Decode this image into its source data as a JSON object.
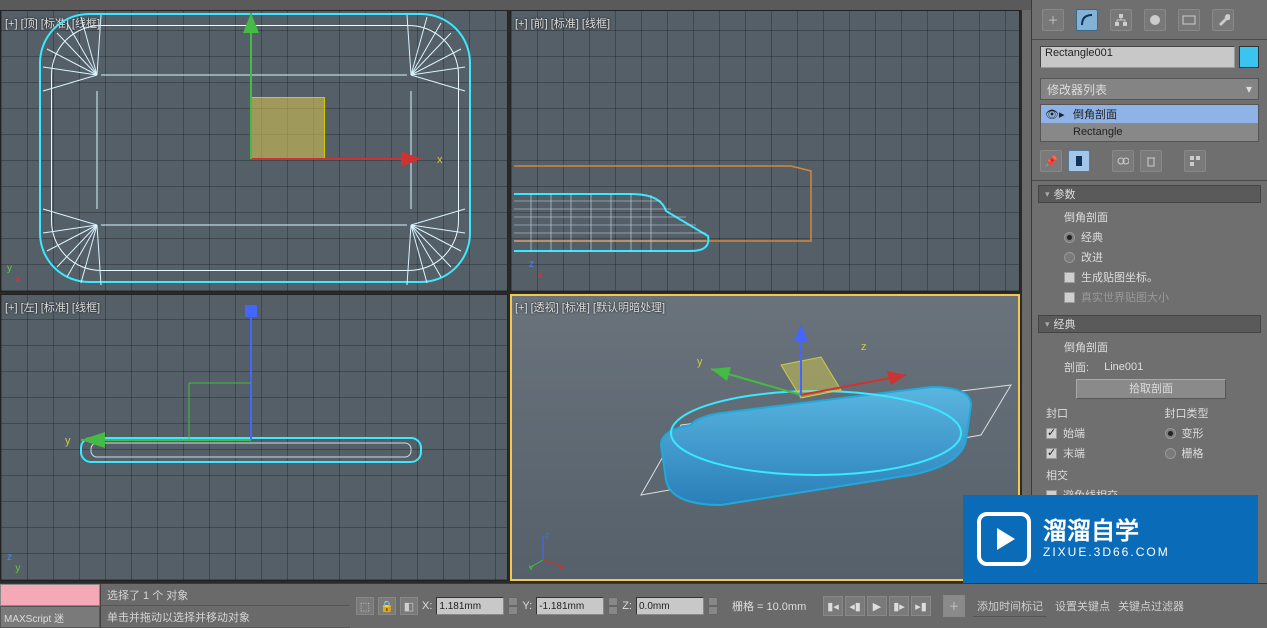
{
  "viewports": {
    "tl": "[+] [顶] [标准] [线框]",
    "tr": "[+] [前] [标准] [线框]",
    "bl": "[+] [左] [标准] [线框]",
    "br": "[+] [透视] [标准] [默认明暗处理]"
  },
  "object_name": "Rectangle001",
  "mod_list_label": "修改器列表",
  "mod_stack": {
    "m0": "倒角剖面",
    "m1": "Rectangle"
  },
  "rollout_params": {
    "title": "参数",
    "bevel_profile": "倒角剖面",
    "classic": "经典",
    "improved": "改进",
    "gen_map": "生成贴图坐标。",
    "real_world": "真实世界贴图大小"
  },
  "rollout_classic": {
    "title": "经典",
    "bevel_profile": "倒角剖面",
    "section_prefix": "剖面:",
    "section_value": "Line001",
    "pick_section": "拾取剖面",
    "cap": "封口",
    "cap_type": "封口类型",
    "start": "始端",
    "end": "末端",
    "morph": "变形",
    "grid": "栅格",
    "intersect": "相交",
    "avoid_cross": "避免线相交"
  },
  "status": {
    "maxscript": "MAXScript 迷",
    "sel": "选择了 1 个 对象",
    "hint": "单击并拖动以选择并移动对象",
    "X": "X:",
    "Xv": "1.181mm",
    "Y": "Y:",
    "Yv": "-1.181mm",
    "Z": "Z:",
    "Zv": "0.0mm",
    "grid": "栅格 = 10.0mm",
    "add_time_tag": "添加时间标记",
    "set_key": "设置关键点",
    "key_filter": "关键点过滤器"
  },
  "watermark": {
    "line1": "溜溜自学",
    "line2": "ZIXUE.3D66.COM"
  },
  "glyph": {
    "tri": "▸",
    "dd": "▾",
    "pin": "📌",
    "lock": "🔒",
    "plus": "＋"
  }
}
